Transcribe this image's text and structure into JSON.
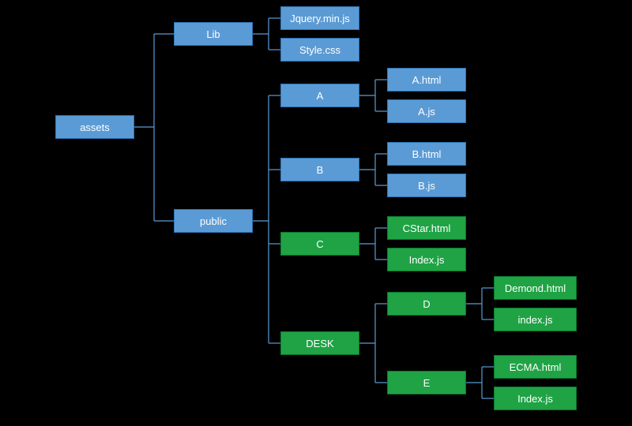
{
  "colors": {
    "blue": "#5b9bd5",
    "green": "#1fa345",
    "blueBorder": "#2e74b5",
    "greenBorder": "#0a7a2c"
  },
  "nodes": {
    "root": {
      "label": "assets",
      "style": "blue"
    },
    "lib": {
      "label": "Lib",
      "style": "blue"
    },
    "public": {
      "label": "public",
      "style": "blue"
    },
    "lib_jquery": {
      "label": "Jquery.min.js",
      "style": "blue"
    },
    "lib_style": {
      "label": "Style.css",
      "style": "blue"
    },
    "folder_a": {
      "label": "A",
      "style": "blue"
    },
    "folder_b": {
      "label": "B",
      "style": "blue"
    },
    "folder_c": {
      "label": "C",
      "style": "green"
    },
    "folder_desk": {
      "label": "DESK",
      "style": "green"
    },
    "file_a_html": {
      "label": "A.html",
      "style": "blue"
    },
    "file_a_js": {
      "label": "A.js",
      "style": "blue"
    },
    "file_b_html": {
      "label": "B.html",
      "style": "blue"
    },
    "file_b_js": {
      "label": "B.js",
      "style": "blue"
    },
    "file_cstar": {
      "label": "CStar.html",
      "style": "green"
    },
    "file_index_c": {
      "label": "Index.js",
      "style": "green"
    },
    "folder_d": {
      "label": "D",
      "style": "green"
    },
    "folder_e": {
      "label": "E",
      "style": "green"
    },
    "file_demond": {
      "label": "Demond.html",
      "style": "green"
    },
    "file_index_d": {
      "label": "index.js",
      "style": "green"
    },
    "file_ecma": {
      "label": "ECMA.html",
      "style": "green"
    },
    "file_index_e": {
      "label": "Index.js",
      "style": "green"
    }
  }
}
